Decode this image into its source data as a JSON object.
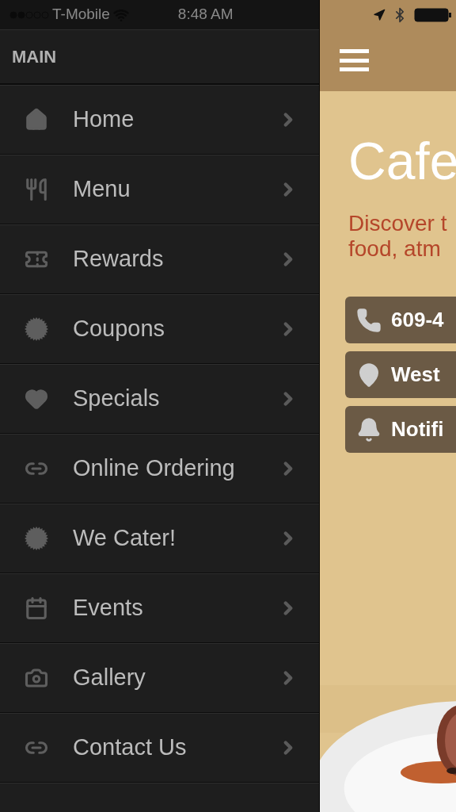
{
  "status_bar": {
    "carrier": "T-Mobile",
    "time": "8:48 AM"
  },
  "sidebar": {
    "title": "MAIN",
    "items": [
      {
        "label": "Home"
      },
      {
        "label": "Menu"
      },
      {
        "label": "Rewards"
      },
      {
        "label": "Coupons"
      },
      {
        "label": "Specials"
      },
      {
        "label": "Online Ordering"
      },
      {
        "label": "We Cater!"
      },
      {
        "label": "Events"
      },
      {
        "label": "Gallery"
      },
      {
        "label": "Contact Us"
      }
    ]
  },
  "main": {
    "title": "Cafe",
    "tagline_lines": [
      "Discover t",
      "food, atm"
    ],
    "actions": [
      {
        "label": "609-4"
      },
      {
        "label": "West"
      },
      {
        "label": "Notifi"
      }
    ]
  }
}
